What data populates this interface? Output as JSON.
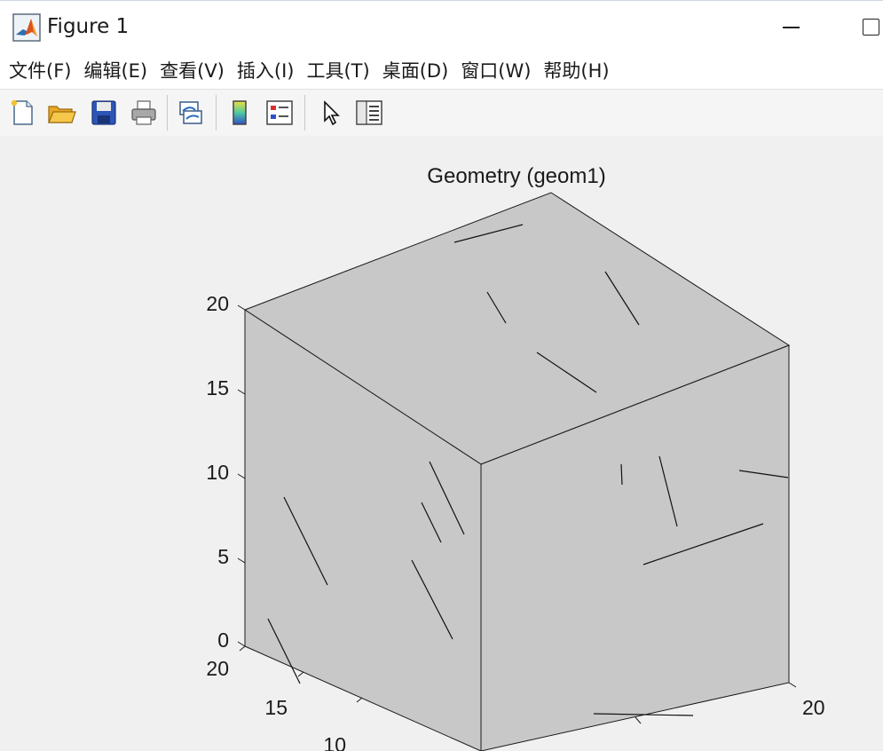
{
  "window": {
    "title": "Figure 1",
    "icon": "matlab-logo-icon",
    "controls": [
      "minimize-icon",
      "maximize-icon"
    ]
  },
  "menu": {
    "items": [
      {
        "label": "文件(F)"
      },
      {
        "label": "编辑(E)"
      },
      {
        "label": "查看(V)"
      },
      {
        "label": "插入(I)"
      },
      {
        "label": "工具(T)"
      },
      {
        "label": "桌面(D)"
      },
      {
        "label": "窗口(W)"
      },
      {
        "label": "帮助(H)"
      }
    ]
  },
  "toolbar": {
    "buttons": [
      {
        "icon": "new-figure-icon"
      },
      {
        "icon": "open-folder-icon"
      },
      {
        "icon": "save-icon"
      },
      {
        "icon": "print-icon"
      },
      {
        "icon": "link-plot-icon"
      },
      {
        "icon": "colorbar-icon"
      },
      {
        "icon": "legend-icon"
      },
      {
        "icon": "pointer-icon"
      },
      {
        "icon": "property-inspector-icon"
      }
    ]
  },
  "chart_data": {
    "type": "3d-geometry",
    "title": "Geometry (geom1)",
    "z_ticks": [
      "0",
      "5",
      "10",
      "15",
      "20"
    ],
    "x_ticks": [
      "20",
      "15",
      "10"
    ],
    "y_ticks": [
      "20"
    ],
    "zlim": [
      0,
      20
    ],
    "face_color": "#c8c8c8",
    "edge_color": "#1a1a1a"
  }
}
